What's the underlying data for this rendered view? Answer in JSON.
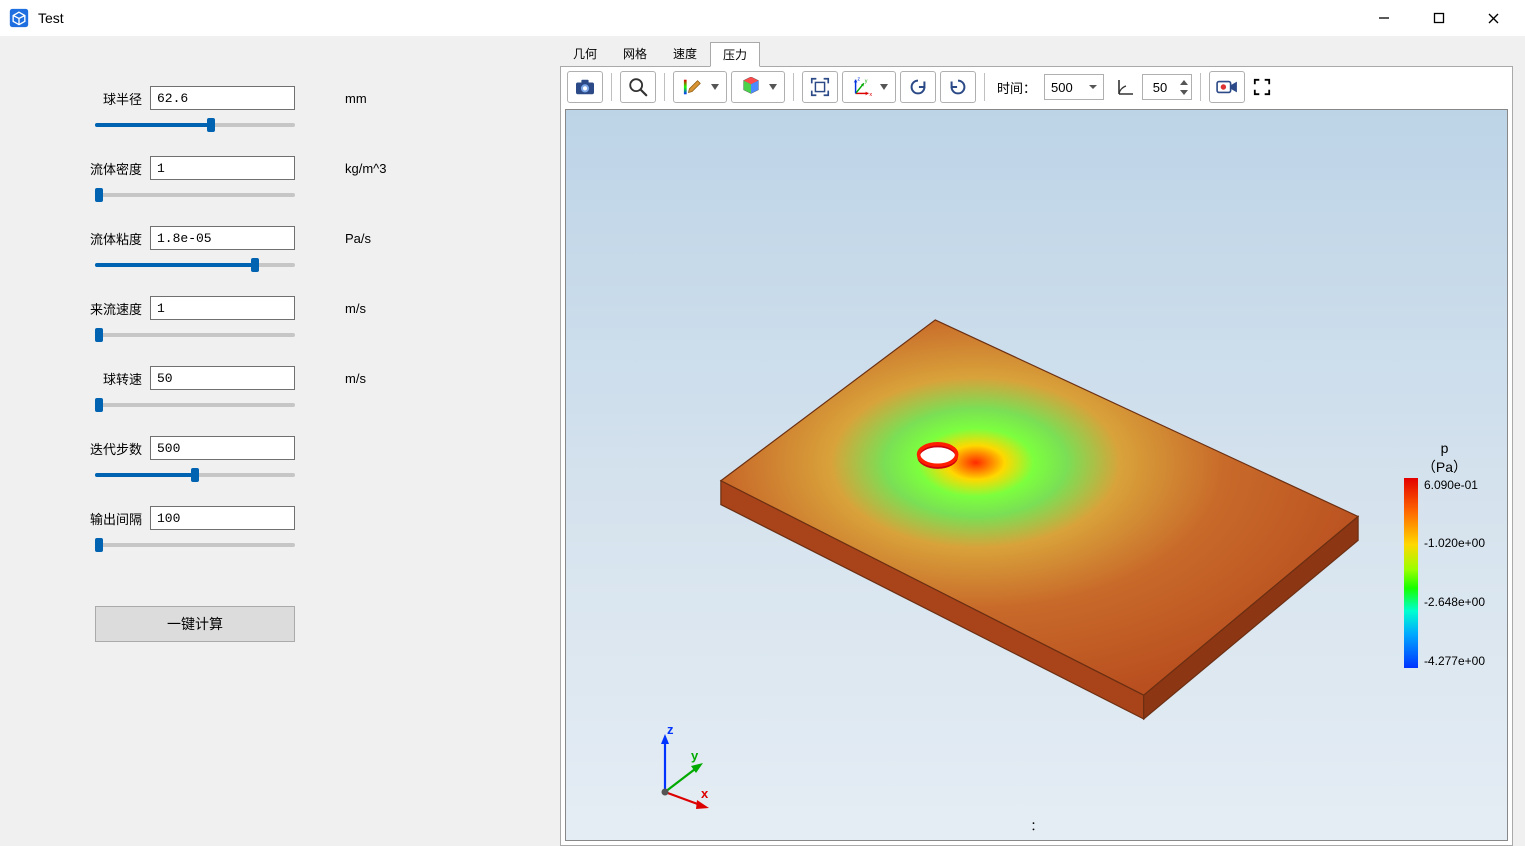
{
  "window": {
    "title": "Test"
  },
  "params": [
    {
      "label": "球半径",
      "value": "62.6",
      "unit": "mm",
      "pos": 58
    },
    {
      "label": "流体密度",
      "value": "1",
      "unit": "kg/m^3",
      "pos": 2
    },
    {
      "label": "流体粘度",
      "value": "1.8e-05",
      "unit": "Pa/s",
      "pos": 80
    },
    {
      "label": "来流速度",
      "value": "1",
      "unit": "m/s",
      "pos": 2
    },
    {
      "label": "球转速",
      "value": "50",
      "unit": "m/s",
      "pos": 2
    },
    {
      "label": "迭代步数",
      "value": "500",
      "unit": "",
      "pos": 50
    },
    {
      "label": "输出间隔",
      "value": "100",
      "unit": "",
      "pos": 2
    }
  ],
  "calc_button": "一键计算",
  "tabs": {
    "items": [
      "几何",
      "网格",
      "速度",
      "压力"
    ],
    "active": 3
  },
  "toolbar": {
    "time_label": "时间：",
    "time_value": "500",
    "angle_value": "50"
  },
  "axes": {
    "x": "x",
    "y": "y",
    "z": "z"
  },
  "colorbar": {
    "title1": "p",
    "title2": "（Pa）",
    "ticks": [
      "6.090e-01",
      "-1.020e+00",
      "-2.648e+00",
      "-4.277e+00"
    ]
  },
  "status_colon": "："
}
